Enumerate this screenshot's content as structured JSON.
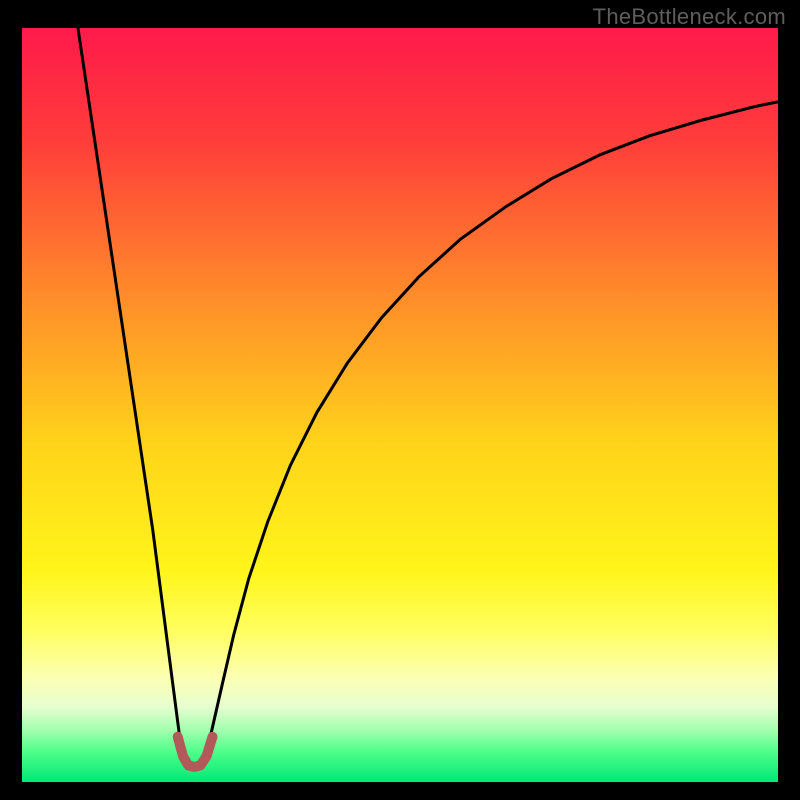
{
  "watermark": "TheBottleneck.com",
  "chart_data": {
    "type": "line",
    "title": "",
    "xlabel": "",
    "ylabel": "",
    "xlim": [
      0,
      100
    ],
    "ylim": [
      0,
      100
    ],
    "grid": false,
    "legend": false,
    "background_gradient": {
      "stops": [
        {
          "offset": 0.0,
          "color": "#ff1a4b"
        },
        {
          "offset": 0.15,
          "color": "#ff3d3a"
        },
        {
          "offset": 0.35,
          "color": "#ff8a2a"
        },
        {
          "offset": 0.55,
          "color": "#ffd31a"
        },
        {
          "offset": 0.72,
          "color": "#fff51a"
        },
        {
          "offset": 0.8,
          "color": "#ffff60"
        },
        {
          "offset": 0.86,
          "color": "#fcffb0"
        },
        {
          "offset": 0.9,
          "color": "#e6ffd0"
        },
        {
          "offset": 0.93,
          "color": "#a6ffb0"
        },
        {
          "offset": 0.96,
          "color": "#4eff8a"
        },
        {
          "offset": 1.0,
          "color": "#00e876"
        }
      ]
    },
    "series": [
      {
        "name": "curve-left",
        "stroke": "#000000",
        "stroke_width": 3,
        "x": [
          7.4,
          8.5,
          9.6,
          10.7,
          11.8,
          12.9,
          14.0,
          15.1,
          16.2,
          17.3,
          18.0,
          18.7,
          19.4,
          20.1,
          20.8
        ],
        "y": [
          100,
          92.6,
          85.2,
          77.8,
          70.4,
          63.0,
          55.6,
          48.2,
          40.8,
          33.4,
          28.0,
          22.6,
          17.2,
          11.8,
          6.4
        ]
      },
      {
        "name": "curve-right",
        "stroke": "#000000",
        "stroke_width": 3,
        "x": [
          25.0,
          26.5,
          28.0,
          30.0,
          32.5,
          35.5,
          39.0,
          43.0,
          47.5,
          52.5,
          58.0,
          64.0,
          70.0,
          76.5,
          83.0,
          90.0,
          97.0,
          100.0
        ],
        "y": [
          6.4,
          13.0,
          19.5,
          27.0,
          34.5,
          42.0,
          49.0,
          55.5,
          61.5,
          67.0,
          72.0,
          76.3,
          80.0,
          83.2,
          85.7,
          87.8,
          89.6,
          90.2
        ]
      },
      {
        "name": "trough-marker",
        "stroke": "#b25a5a",
        "stroke_width": 10,
        "linecap": "round",
        "x": [
          20.6,
          21.3,
          22.0,
          22.8,
          23.6,
          24.4,
          25.2
        ],
        "y": [
          6.0,
          3.4,
          2.2,
          2.0,
          2.2,
          3.4,
          6.0
        ]
      }
    ]
  }
}
